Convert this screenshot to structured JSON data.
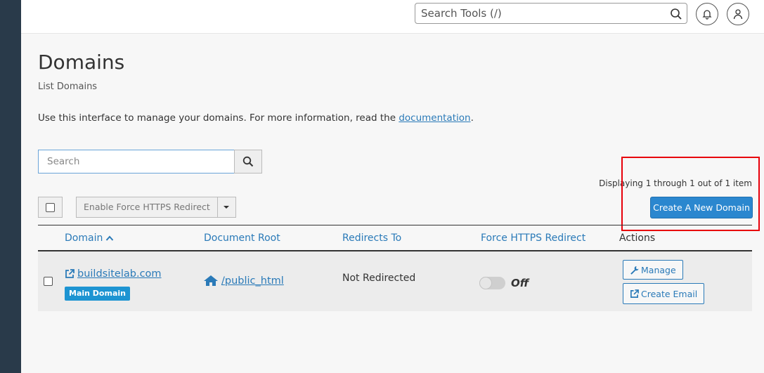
{
  "topbar": {
    "search_placeholder": "Search Tools (/)",
    "icons": [
      "search-icon",
      "bell-icon",
      "user-icon"
    ]
  },
  "page": {
    "title": "Domains",
    "subtitle": "List Domains",
    "intro_text": "Use this interface to manage your domains. For more information, read the ",
    "intro_link": "documentation",
    "intro_end": "."
  },
  "list_controls": {
    "search_placeholder": "Search",
    "force_https_button": "Enable Force HTTPS Redirect",
    "create_button": "Create A New Domain",
    "paging_info": "Displaying 1 through 1 out of 1 item"
  },
  "table": {
    "headers": {
      "domain": "Domain",
      "document_root": "Document Root",
      "redirects_to": "Redirects To",
      "force_https": "Force HTTPS Redirect",
      "actions": "Actions"
    },
    "rows": [
      {
        "domain": "buildsitelab.com",
        "badge": "Main Domain",
        "document_root": "/public_html",
        "redirects_to": "Not Redirected",
        "force_https": "Off",
        "manage_label": "Manage",
        "create_email_label": "Create Email"
      }
    ]
  },
  "colors": {
    "accent": "#2b87cf",
    "link": "#2a7ab8",
    "badge": "#1d94d2",
    "highlight": "#e8000b",
    "left_rail": "#293a4a"
  }
}
